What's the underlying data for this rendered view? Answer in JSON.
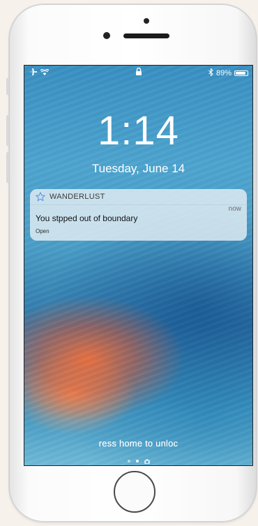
{
  "status_bar": {
    "battery_text": "89%",
    "battery_level": 0.89,
    "airplane_icon": "airplane-icon",
    "wifi_icon": "wifi-icon",
    "lock_icon": "lock-icon",
    "bluetooth_icon": "bluetooth-icon"
  },
  "lock_screen": {
    "time": "1:14",
    "date": "Tuesday, June 14",
    "unlock_hint": "ress home to unloc"
  },
  "notification": {
    "app_icon": "star-icon",
    "app_name": "WANDERLUST",
    "time": "now",
    "message": "You stpped out of boundary",
    "action": "Open"
  },
  "colors": {
    "notification_bg": "#ecf2f6",
    "app_icon_color": "#6c9ae6"
  }
}
